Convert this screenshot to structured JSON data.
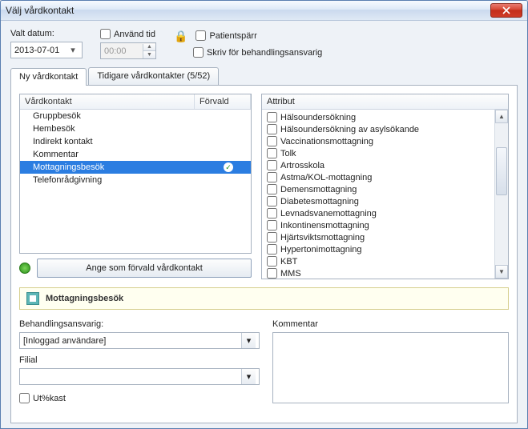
{
  "window": {
    "title": "Välj vårdkontakt"
  },
  "top": {
    "date_label": "Valt datum:",
    "date_value": "2013-07-01",
    "use_time_label": "Använd tid",
    "time_value": "00:00",
    "patient_lock_label": "Patientspärr",
    "skriv_label": "Skriv för behandlingsansvarig"
  },
  "tabs": {
    "new": "Ny vårdkontakt",
    "previous": "Tidigare vårdkontakter (5/52)"
  },
  "list": {
    "header_contact": "Vårdkontakt",
    "header_default": "Förvald",
    "items": [
      {
        "label": "Gruppbesök"
      },
      {
        "label": "Hembesök"
      },
      {
        "label": "Indirekt kontakt"
      },
      {
        "label": "Kommentar"
      },
      {
        "label": "Mottagningsbesök",
        "selected": true
      },
      {
        "label": "Telefonrådgivning"
      }
    ],
    "set_default_button": "Ange som förvald vårdkontakt"
  },
  "attributes": {
    "header": "Attribut",
    "items": [
      "Hälsoundersökning",
      "Hälsoundersökning av asylsökande",
      "Vaccinationsmottagning",
      "Tolk",
      "Artrosskola",
      "Astma/KOL-mottagning",
      "Demensmottagning",
      "Diabetesmottagning",
      "Levnadsvanemottagning",
      "Inkontinensmottagning",
      "Hjärtsviktsmottagning",
      "Hypertonimottagning",
      "KBT",
      "MMS"
    ]
  },
  "banner": {
    "selected_label": "Mottagningsbesök"
  },
  "bottom": {
    "responsible_label": "Behandlingsansvarig:",
    "responsible_value": "[Inloggad användare]",
    "filial_label": "Filial",
    "filial_value": "",
    "comment_label": "Kommentar",
    "utkast_label": "Ut%kast"
  }
}
